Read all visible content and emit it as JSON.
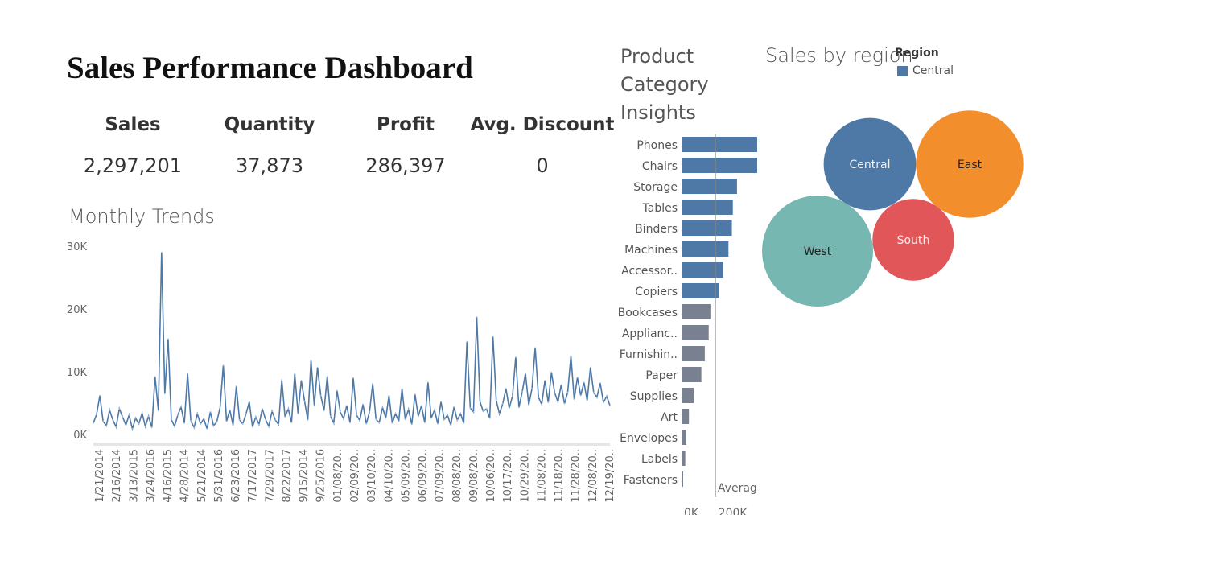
{
  "dashboard": {
    "title": "Sales Performance Dashboard"
  },
  "kpis": [
    {
      "label": "Sales",
      "value": "2,297,201"
    },
    {
      "label": "Quantity",
      "value": "37,873"
    },
    {
      "label": "Profit",
      "value": "286,397"
    },
    {
      "label": "Avg. Discount",
      "value": "0"
    }
  ],
  "colors": {
    "primary": "#4e79a7",
    "muted": "#79808f",
    "east": "#f28e2b",
    "south": "#e15759",
    "west": "#76b7b2"
  },
  "chart_data": [
    {
      "type": "line",
      "title": "Monthly Trends",
      "ylim": [
        0,
        31000
      ],
      "yticks": [
        "30K",
        "20K",
        "10K",
        "0K"
      ],
      "ytick_values": [
        30000,
        20000,
        10000,
        0
      ],
      "xtick_labels": [
        "1/21/2014",
        "2/16/2014",
        "3/13/2015",
        "3/24/2016",
        "4/16/2015",
        "4/28/2014",
        "5/21/2014",
        "5/31/2016",
        "6/23/2016",
        "7/17/2017",
        "7/29/2017",
        "8/22/2017",
        "9/15/2014",
        "9/25/2016",
        "01/08/20..",
        "02/09/20..",
        "03/10/20..",
        "04/10/20..",
        "05/09/20..",
        "06/09/20..",
        "07/09/20..",
        "08/08/20..",
        "09/08/20..",
        "10/06/20..",
        "10/17/20..",
        "10/29/20..",
        "11/08/20..",
        "11/18/20..",
        "11/28/20..",
        "12/08/20..",
        "12/19/20.."
      ],
      "series": [
        {
          "values": [
            1800,
            3200,
            6200,
            2100,
            1400,
            3900,
            2300,
            1200,
            4100,
            2800,
            1500,
            3100,
            900,
            2600,
            1700,
            3400,
            1300,
            2900,
            1100,
            9200,
            3800,
            29000,
            6500,
            15200,
            2400,
            1300,
            3100,
            4400,
            1800,
            9700,
            2200,
            1100,
            3300,
            1700,
            2500,
            900,
            3600,
            1400,
            2000,
            4300,
            11000,
            2100,
            3900,
            1500,
            7700,
            2300,
            1700,
            3300,
            5200,
            1200,
            2800,
            1600,
            4100,
            2400,
            1300,
            3700,
            2300,
            1600,
            8700,
            2800,
            4100,
            1900,
            9700,
            3300,
            8600,
            5300,
            2300,
            11800,
            4600,
            10700,
            6200,
            3800,
            9300,
            2900,
            1800,
            7000,
            3600,
            2500,
            4600,
            1900,
            9000,
            3100,
            2200,
            4800,
            1700,
            3600,
            8100,
            2400,
            1900,
            4300,
            2600,
            6200,
            1800,
            3300,
            2100,
            7300,
            2400,
            4000,
            1600,
            6400,
            2900,
            4600,
            1900,
            8300,
            2600,
            3900,
            1700,
            5200,
            2400,
            3100,
            1500,
            4400,
            2300,
            3300,
            1800,
            14800,
            4200,
            3600,
            18700,
            5200,
            3700,
            4100,
            2600,
            15600,
            5400,
            3300,
            4900,
            7300,
            4200,
            6100,
            12300,
            4300,
            6800,
            9700,
            4700,
            7300,
            13800,
            5900,
            4800,
            8600,
            5100,
            9900,
            6600,
            5200,
            7900,
            4900,
            6700,
            12500,
            5600,
            9100,
            6200,
            8300,
            5400,
            10700,
            6700,
            5900,
            8200,
            5100,
            6100,
            4600
          ]
        }
      ]
    },
    {
      "type": "bar",
      "title": "Product Category Insights",
      "categories": [
        "Phones",
        "Chairs",
        "Storage",
        "Tables",
        "Binders",
        "Machines",
        "Accessor..",
        "Copiers",
        "Bookcases",
        "Applianc..",
        "Furnishin..",
        "Paper",
        "Supplies",
        "Art",
        "Envelopes",
        "Labels",
        "Fasteners"
      ],
      "values": [
        330000,
        328000,
        224000,
        207000,
        203000,
        189000,
        167000,
        150000,
        115000,
        108000,
        92000,
        78000,
        47000,
        27000,
        16000,
        12000,
        3000
      ],
      "highlighted": [
        true,
        true,
        true,
        true,
        true,
        true,
        true,
        true,
        false,
        false,
        false,
        false,
        false,
        false,
        false,
        false,
        false
      ],
      "xticks": [
        "0K",
        "200K"
      ],
      "xtick_values": [
        0,
        200000
      ],
      "reference_line": {
        "label": "Average",
        "value": 135000
      }
    },
    {
      "type": "bubble",
      "title": "Sales by region",
      "legend_title": "Region",
      "legend": [
        "Central"
      ],
      "categories": [
        "Central",
        "East",
        "South",
        "West"
      ],
      "values": [
        501240,
        678781,
        391722,
        725458
      ]
    }
  ]
}
